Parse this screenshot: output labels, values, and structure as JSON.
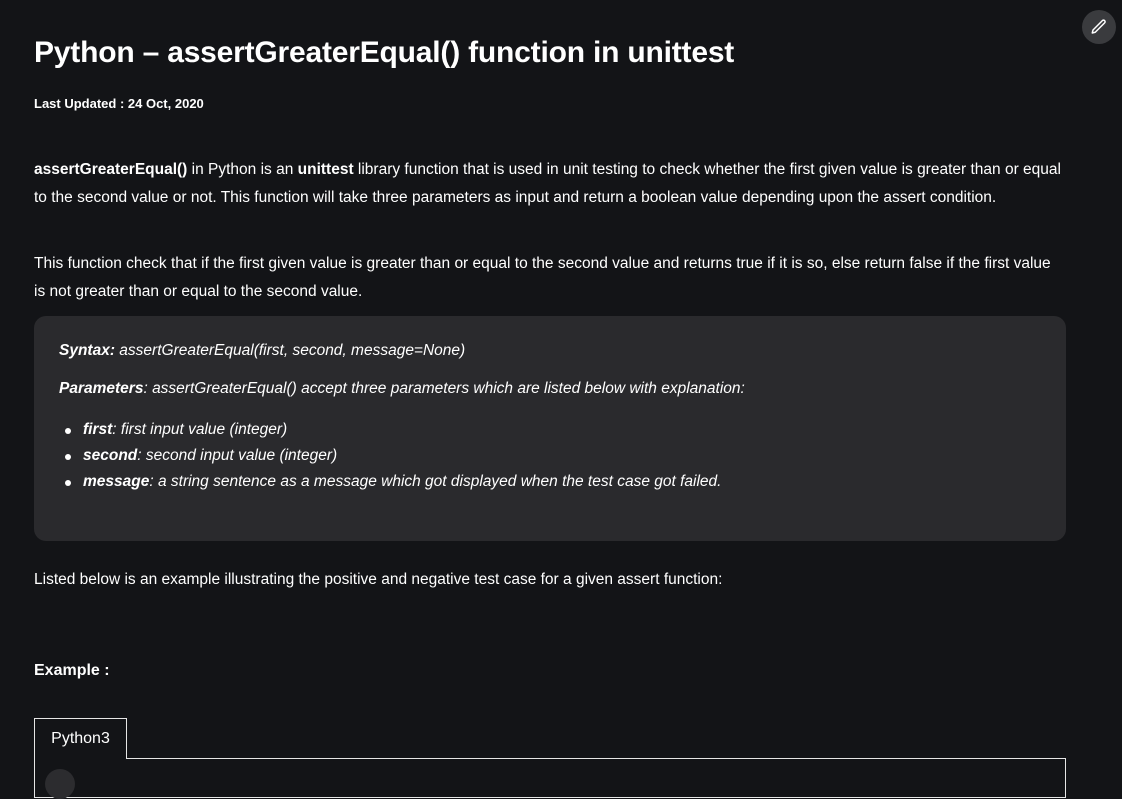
{
  "article": {
    "title": "Python – assertGreaterEqual() function in unittest",
    "last_updated": "Last Updated : 24 Oct, 2020",
    "intro": {
      "fn_name": "assertGreaterEqual()",
      "text_1": " in Python is an ",
      "lib_name": "unittest",
      "text_2": " library function that is used in unit testing to check whether the first given value is greater than or equal to the second value or not. This function will take three parameters as input and return a boolean value depending upon the assert condition."
    },
    "paragraph_2": "This function check that if the first given value is greater than or equal to the second value and returns true if it is so, else return false if the first value is not greater than or equal to the second value.",
    "syntax_box": {
      "syntax_label": "Syntax:",
      "syntax_value": " assertGreaterEqual(first, second, message=None)",
      "params_label": "Parameters",
      "params_value": ": assertGreaterEqual() accept three parameters which are listed below with explanation:",
      "params": [
        {
          "name": "first",
          "desc": ": first input value (integer)"
        },
        {
          "name": "second",
          "desc": ":  second input value (integer)"
        },
        {
          "name": "message",
          "desc": ": a string sentence as a message which got displayed when the test case got failed."
        }
      ]
    },
    "paragraph_3": "Listed below is an example illustrating the positive and negative test case for a given assert function:",
    "example_heading": "Example :",
    "code_tab_label": "Python3"
  },
  "toolbar": {
    "edit_icon": "pencil-icon"
  }
}
